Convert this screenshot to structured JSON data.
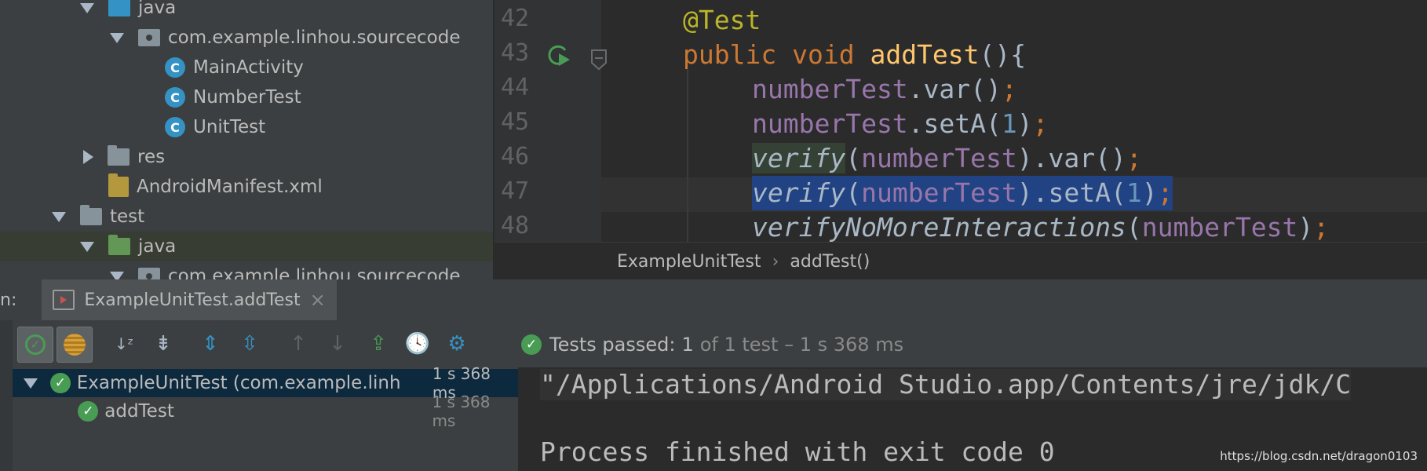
{
  "tree": {
    "items": [
      {
        "label": "java"
      },
      {
        "label": "com.example.linhou.sourcecode"
      },
      {
        "label": "MainActivity"
      },
      {
        "label": "NumberTest"
      },
      {
        "label": "UnitTest"
      },
      {
        "label": "res"
      },
      {
        "label": "AndroidManifest.xml"
      },
      {
        "label": "test"
      },
      {
        "label": "java"
      },
      {
        "label": "com.example.linhou.sourcecode"
      }
    ],
    "class_icon_letter": "C"
  },
  "editor": {
    "line_numbers": [
      "42",
      "43",
      "44",
      "45",
      "46",
      "47",
      "48"
    ],
    "code": {
      "l42": {
        "ann": "@Test"
      },
      "l43": {
        "kw1": "public",
        "kw2": "void",
        "fn": "addTest",
        "rest": "(){"
      },
      "l44": {
        "fld": "numberTest",
        "rest": ".var()",
        "semi": ";"
      },
      "l45": {
        "fld": "numberTest",
        "mid": ".setA(",
        "num": "1",
        "end": ")",
        "semi": ";"
      },
      "l46": {
        "fn": "verify",
        "open": "(",
        "fld": "numberTest",
        "rest": ").var()",
        "semi": ";"
      },
      "l47": {
        "fn": "verify",
        "open": "(",
        "fld": "numberTest",
        "mid": ").setA(",
        "num": "1",
        "end": ")",
        "semi": ";"
      },
      "l48": {
        "fn": "verifyNoMoreInteractions",
        "open": "(",
        "fld": "numberTest",
        "end": ")",
        "semi": ";"
      }
    }
  },
  "breadcrumb": {
    "class": "ExampleUnitTest",
    "sep": "›",
    "method": "addTest()"
  },
  "run": {
    "prefix": "n:",
    "tab_label": "ExampleUnitTest.addTest",
    "close": "×"
  },
  "status": {
    "passed": "Tests passed:",
    "count": "1",
    "rest": "of 1 test – 1 s 368 ms"
  },
  "results": [
    {
      "label": "ExampleUnitTest (com.example.linh",
      "time": "1 s 368 ms"
    },
    {
      "label": "addTest",
      "time": "1 s 368 ms"
    }
  ],
  "console": {
    "line1": "\"/Applications/Android Studio.app/Contents/jre/jdk/C",
    "line2": "Process finished with exit code 0"
  },
  "watermark": "https://blog.csdn.net/dragon0103",
  "colors": {
    "accent_green": "#499c54",
    "selection_blue": "#214283",
    "class_icon_blue": "#3592c4"
  }
}
